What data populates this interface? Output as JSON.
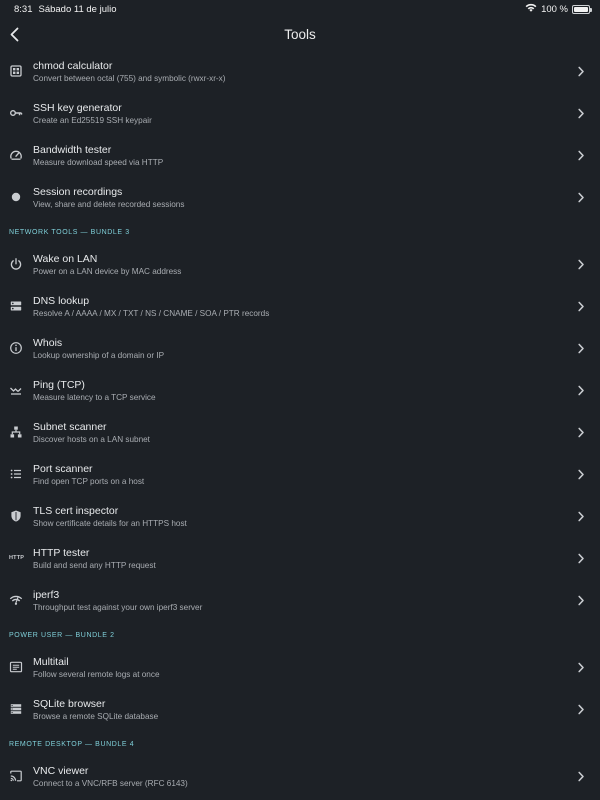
{
  "status": {
    "time": "8:31",
    "date": "Sábado 11 de julio",
    "battery": "100 %"
  },
  "header": {
    "title": "Tools"
  },
  "groups": [
    {
      "section": "",
      "items": [
        {
          "title": "chmod calculator",
          "subtitle": "Convert between octal (755) and symbolic (rwxr-xr-x)",
          "icon": "grid-icon"
        },
        {
          "title": "SSH key generator",
          "subtitle": "Create an Ed25519 SSH keypair",
          "icon": "key-icon"
        },
        {
          "title": "Bandwidth tester",
          "subtitle": "Measure download speed via HTTP",
          "icon": "speedometer-icon"
        },
        {
          "title": "Session recordings",
          "subtitle": "View, share and delete recorded sessions",
          "icon": "record-dot-icon"
        }
      ]
    },
    {
      "section": "NETWORK TOOLS — BUNDLE 3",
      "items": [
        {
          "title": "Wake on LAN",
          "subtitle": "Power on a LAN device by MAC address",
          "icon": "power-icon"
        },
        {
          "title": "DNS lookup",
          "subtitle": "Resolve A / AAAA / MX / TXT / NS / CNAME / SOA / PTR records",
          "icon": "dns-icon"
        },
        {
          "title": "Whois",
          "subtitle": "Lookup ownership of a domain or IP",
          "icon": "info-icon"
        },
        {
          "title": "Ping (TCP)",
          "subtitle": "Measure latency to a TCP service",
          "icon": "ping-icon"
        },
        {
          "title": "Subnet scanner",
          "subtitle": "Discover hosts on a LAN subnet",
          "icon": "network-tree-icon"
        },
        {
          "title": "Port scanner",
          "subtitle": "Find open TCP ports on a host",
          "icon": "list-icon"
        },
        {
          "title": "TLS cert inspector",
          "subtitle": "Show certificate details for an HTTPS host",
          "icon": "shield-icon"
        },
        {
          "title": "HTTP tester",
          "subtitle": "Build and send any HTTP request",
          "icon": "http-icon",
          "icon_text": "HTTP"
        },
        {
          "title": "iperf3",
          "subtitle": "Throughput test against your own iperf3 server",
          "icon": "wifi-icon"
        }
      ]
    },
    {
      "section": "POWER USER — BUNDLE 2",
      "items": [
        {
          "title": "Multitail",
          "subtitle": "Follow several remote logs at once",
          "icon": "terminal-icon"
        },
        {
          "title": "SQLite browser",
          "subtitle": "Browse a remote SQLite database",
          "icon": "database-list-icon"
        }
      ]
    },
    {
      "section": "REMOTE DESKTOP — BUNDLE 4",
      "items": [
        {
          "title": "VNC viewer",
          "subtitle": "Connect to a VNC/RFB server (RFC 6143)",
          "icon": "cast-icon"
        }
      ]
    }
  ]
}
